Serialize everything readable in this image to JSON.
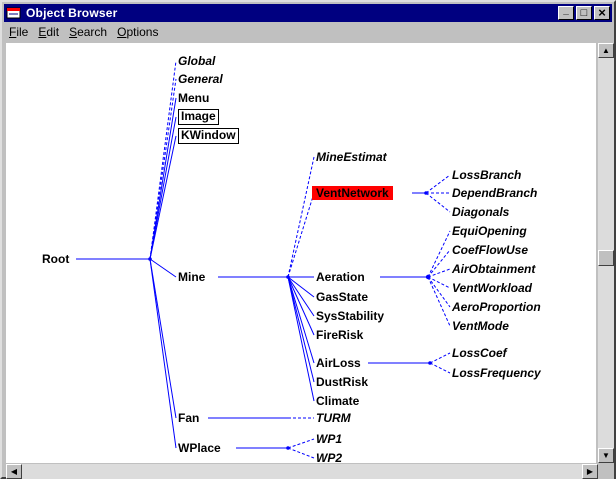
{
  "window": {
    "title": "Object Browser",
    "minimize": "_",
    "maximize": "□",
    "close": "×"
  },
  "menu": [
    {
      "key": "F",
      "rest": "ile"
    },
    {
      "key": "E",
      "rest": "dit"
    },
    {
      "key": "S",
      "rest": "earch"
    },
    {
      "key": "O",
      "rest": "ptions"
    }
  ],
  "tree": {
    "root": "Root",
    "global": "Global",
    "general": "General",
    "menu": "Menu",
    "image": "Image",
    "kwindow": "KWindow",
    "mine": "Mine",
    "fan": "Fan",
    "wplace": "WPlace",
    "mine_estimat": "MineEstimat",
    "vent_network": "VentNetwork",
    "aeration": "Aeration",
    "gas_state": "GasState",
    "sys_stability": "SysStability",
    "fire_risk": "FireRisk",
    "air_loss": "AirLoss",
    "dust_risk": "DustRisk",
    "climate": "Climate",
    "loss_branch": "LossBranch",
    "depend_branch": "DependBranch",
    "diagonals": "Diagonals",
    "equi_opening": "EquiOpening",
    "coef_flow_use": "CoefFlowUse",
    "air_obtainment": "AirObtainment",
    "vent_workload": "VentWorkload",
    "aero_proportion": "AeroProportion",
    "vent_mode": "VentMode",
    "loss_coef": "LossCoef",
    "loss_frequency": "LossFrequency",
    "turm": "TURM",
    "wp1": "WP1",
    "wp2": "WP2"
  },
  "colors": {
    "link": "#0000ff",
    "title_bar": "#000080",
    "selected": "#ff0000"
  }
}
